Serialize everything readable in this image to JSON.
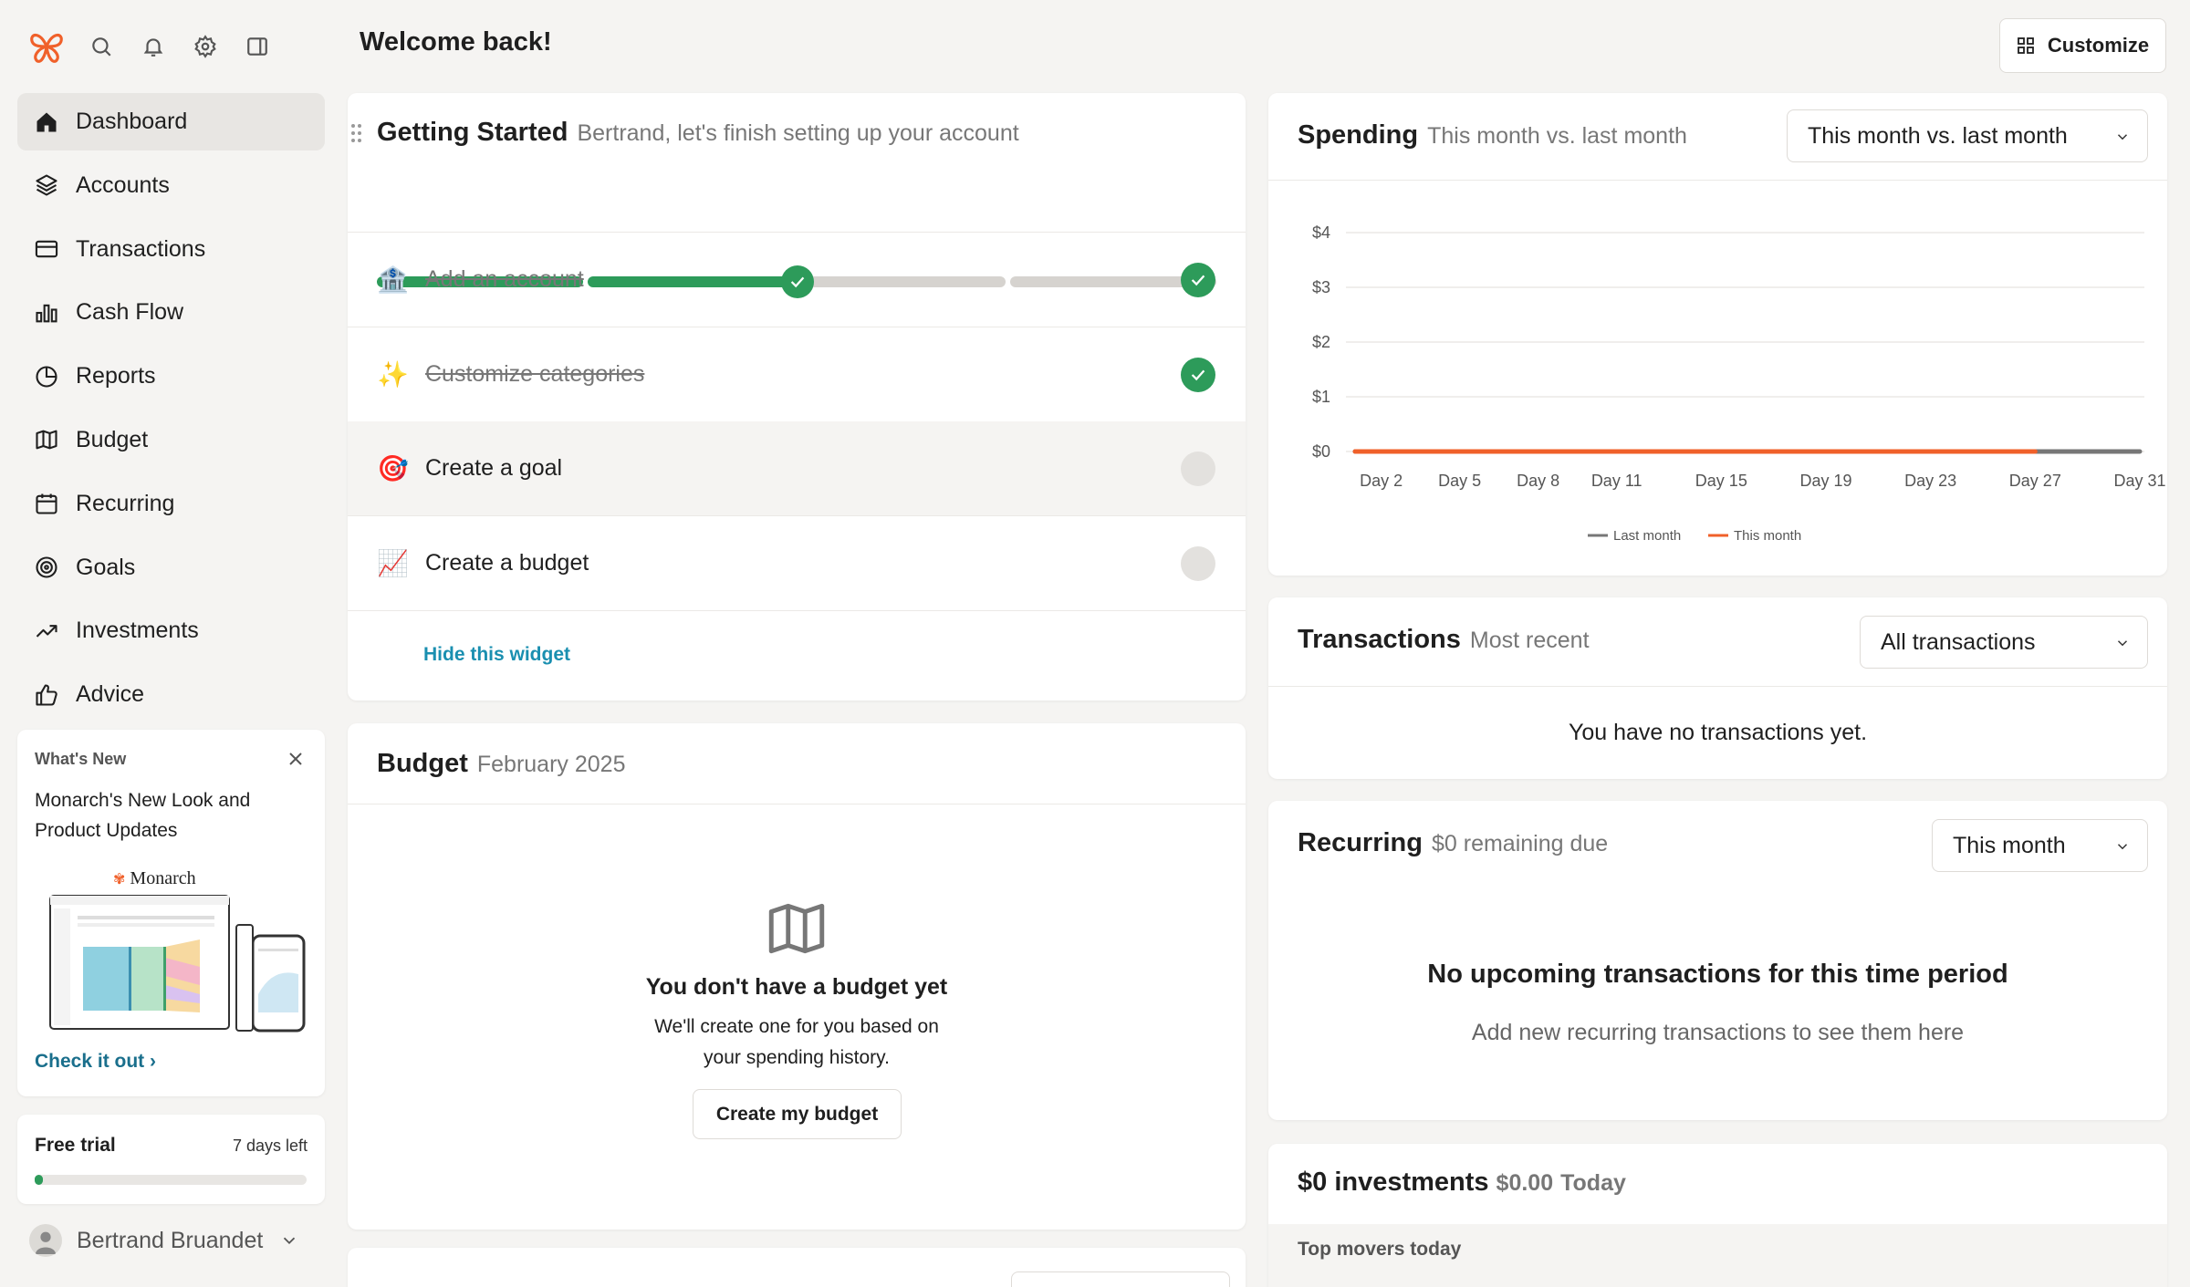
{
  "header": {
    "welcome": "Welcome back!",
    "customize_label": "Customize"
  },
  "sidebar": {
    "items": [
      {
        "label": "Dashboard",
        "icon": "home-icon",
        "active": true
      },
      {
        "label": "Accounts",
        "icon": "layers-icon"
      },
      {
        "label": "Transactions",
        "icon": "credit-card-icon"
      },
      {
        "label": "Cash Flow",
        "icon": "bar-chart-icon"
      },
      {
        "label": "Reports",
        "icon": "pie-chart-icon"
      },
      {
        "label": "Budget",
        "icon": "map-icon"
      },
      {
        "label": "Recurring",
        "icon": "calendar-icon"
      },
      {
        "label": "Goals",
        "icon": "target-icon"
      },
      {
        "label": "Investments",
        "icon": "trending-up-icon"
      },
      {
        "label": "Advice",
        "icon": "thumbs-up-icon"
      }
    ],
    "whats_new": {
      "heading": "What's New",
      "title": "Monarch's New Look and Product Updates",
      "brand": "Monarch",
      "link": "Check it out ›"
    },
    "free_trial": {
      "label": "Free trial",
      "days_left": "7 days left",
      "progress": 0.03
    },
    "user": {
      "name": "Bertrand Bruandet"
    }
  },
  "getting_started": {
    "title": "Getting Started",
    "subtitle": "Bertrand, let's finish setting up your account",
    "progress_steps": 4,
    "completed_steps": 2,
    "tasks": [
      {
        "label": "Add an account",
        "emoji": "🏦",
        "done": true
      },
      {
        "label": "Customize categories",
        "emoji": "✨",
        "done": true
      },
      {
        "label": "Create a goal",
        "emoji": "🎯",
        "done": false
      },
      {
        "label": "Create a budget",
        "emoji": "📈",
        "done": false
      }
    ],
    "hide_link": "Hide this widget"
  },
  "budget": {
    "title": "Budget",
    "subtitle": "February 2025",
    "empty_heading": "You don't have a budget yet",
    "empty_text_line1": "We'll create one for you based on",
    "empty_text_line2": "your spending history.",
    "button": "Create my budget"
  },
  "spending": {
    "title": "Spending",
    "subtitle": "This month vs. last month",
    "dropdown": "This month vs. last month"
  },
  "chart_data": {
    "type": "line",
    "x_ticks": [
      "Day 2",
      "Day 5",
      "Day 8",
      "Day 11",
      "Day 15",
      "Day 19",
      "Day 23",
      "Day 27",
      "Day 31"
    ],
    "y_ticks": [
      "$4",
      "$3",
      "$2",
      "$1",
      "$0"
    ],
    "ylim": [
      0,
      4
    ],
    "xlim": [
      1,
      31
    ],
    "grid": true,
    "legend_placement": "bottom",
    "series": [
      {
        "name": "Last month",
        "color": "#777777",
        "x": [
          1,
          31
        ],
        "values": [
          0,
          0
        ]
      },
      {
        "name": "This month",
        "color": "#f0602a",
        "x": [
          1,
          27
        ],
        "values": [
          0,
          0
        ]
      }
    ]
  },
  "transactions": {
    "title": "Transactions",
    "subtitle": "Most recent",
    "dropdown": "All transactions",
    "empty": "You have no transactions yet."
  },
  "recurring": {
    "title": "Recurring",
    "subtitle": "$0 remaining due",
    "dropdown": "This month",
    "empty_heading": "No upcoming transactions for this time period",
    "empty_text": "Add new recurring transactions to see them here"
  },
  "investments": {
    "title": "$0 investments",
    "amount": "$0.00",
    "period": "Today",
    "top_movers": "Top movers today"
  },
  "colors": {
    "accent_green": "#2d9b5a",
    "brand_orange": "#f0602a",
    "link_blue": "#1a8fb0"
  }
}
